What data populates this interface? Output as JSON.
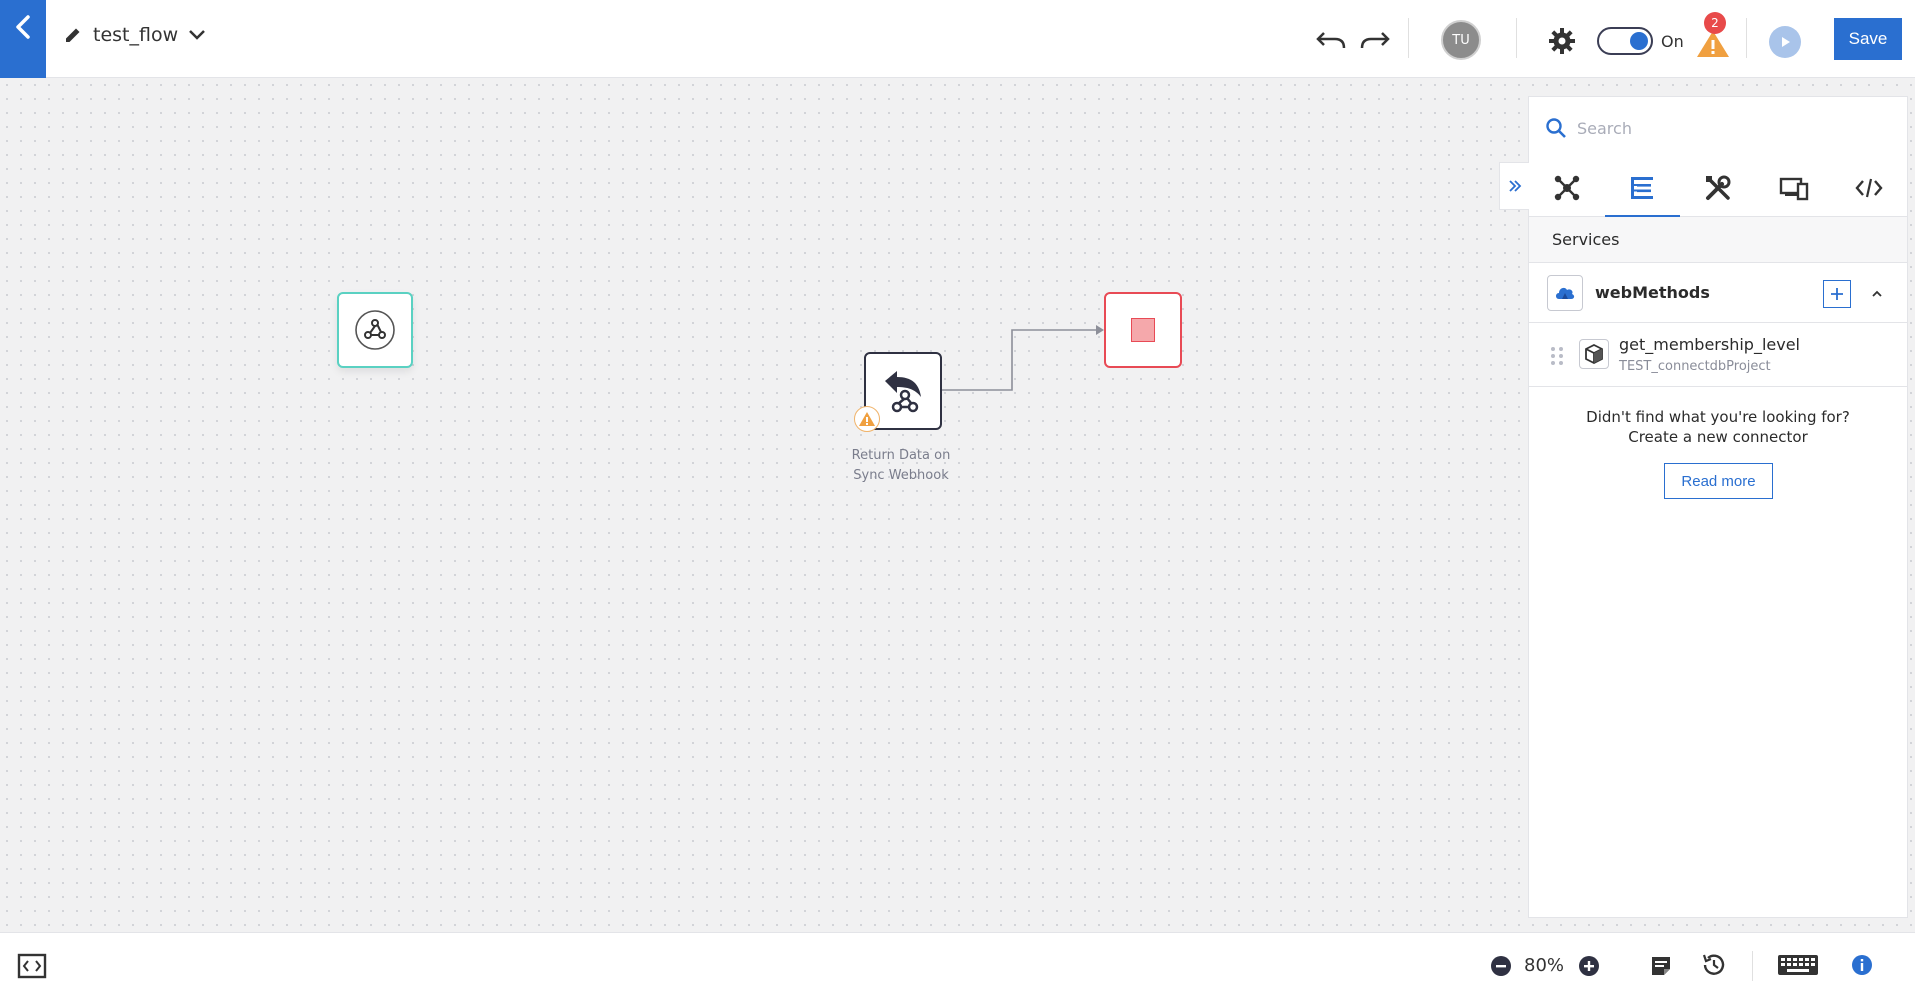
{
  "header": {
    "flow_name": "test_flow",
    "avatar_initials": "TU",
    "toggle_label": "On",
    "alert_count": "2",
    "save_label": "Save"
  },
  "canvas": {
    "nodes": [
      {
        "name": "webhook-trigger",
        "icon": "webhook-icon"
      },
      {
        "name": "return-data-node",
        "icon": "return-webhook-icon",
        "label": "Return Data on Sync Webhook"
      },
      {
        "name": "stop-node",
        "icon": "stop-icon"
      }
    ],
    "return_label_line1": "Return Data on",
    "return_label_line2": "Sync Webhook"
  },
  "panel": {
    "search_placeholder": "Search",
    "tabs": [
      {
        "icon": "connectors-icon"
      },
      {
        "icon": "services-icon",
        "active": true
      },
      {
        "icon": "tools-icon"
      },
      {
        "icon": "devices-icon"
      },
      {
        "icon": "code-icon"
      }
    ],
    "section_title": "Services",
    "group": {
      "label": "webMethods",
      "icon": "cloud-icon"
    },
    "service": {
      "name": "get_membership_level",
      "project": "TEST_connectdbProject"
    },
    "help_line1": "Didn't find what you're looking for?",
    "help_line2": "Create a new connector",
    "read_more": "Read more"
  },
  "footer": {
    "zoom": "80%"
  },
  "colors": {
    "accent": "#2a6fd0",
    "trigger_border": "#5ad1c2",
    "stop_border": "#e84a55",
    "alert": "#e84a4a",
    "warning": "#f0a040"
  }
}
